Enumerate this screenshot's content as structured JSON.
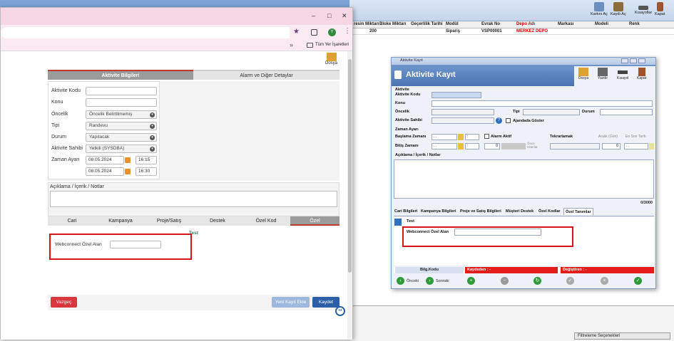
{
  "desktop": {
    "toolbar": [
      {
        "label": "Kartını Aç",
        "icon": "card-icon"
      },
      {
        "label": "Kaydı Aç",
        "icon": "record-icon"
      },
      {
        "label": "Kısayollar",
        "icon": "shortcuts-icon"
      },
      {
        "label": "Kapat",
        "icon": "close-door-icon"
      }
    ],
    "grid_headers": [
      "resin Miktarı",
      "Bloke Miktarı",
      "Geçerlilik Tarihi",
      "Modül",
      "Evrak No",
      "Depo Adı",
      "Markası",
      "Modeli",
      "Renk"
    ],
    "grid_row": [
      "200",
      "",
      "",
      "Sipariş",
      "VSP00001",
      "MERKEZ DEPO",
      "",
      "",
      ""
    ],
    "filter_label": "Filtreleme Seçenekleri"
  },
  "browser": {
    "bookmark": "Tüm Yer İşaretleri",
    "profile": "Y",
    "toolbar": {
      "dosya": "Dosya"
    },
    "tabs": {
      "active": "Aktivite Bilgileri",
      "other": "Alarm ve Diğer Detaylar"
    },
    "form": {
      "labels": {
        "code": "Aktivite Kodu",
        "subject": "Konu",
        "priority": "Öncelik",
        "type": "Tipi",
        "status": "Durum",
        "owner": "Aktivite Sahibi",
        "time": "Zaman Ayarı"
      },
      "priority": "Öncelik Belirtilmemiş",
      "type": "Randevu",
      "status": "Yapılacak",
      "owner": "Yetkili  (SYSDBA)",
      "start_date": "08.05.2024",
      "start_time": "16:15",
      "end_date": "08.05.2024",
      "end_time": "16:30",
      "notes_label": "Açıklama / İçerik / Notlar"
    },
    "subtabs": [
      "Cari",
      "Kampanya",
      "Proje/Satış",
      "Destek",
      "Özel Kod",
      "Özel"
    ],
    "special": {
      "group": "Test",
      "field_label": "Webconnect Özel Alan"
    },
    "buttons": {
      "cancel": "Vazgeç",
      "new": "Yeni Kayıt Ekle",
      "save": "Kaydet"
    }
  },
  "dialog": {
    "window_title": "Aktivite Kayıt",
    "title": "Aktivite Kayıt",
    "toolbar": [
      "Dosya",
      "Yazdır",
      "Kısayol",
      "Kapat"
    ],
    "section": "Aktivite",
    "labels": {
      "code": "Aktivite Kodu",
      "subject": "Konu",
      "priority": "Öncelik",
      "owner": "Aktivite Sahibi",
      "type": "Tipi",
      "status": "Durum",
      "agenda": "Ajandada Göster",
      "time": "Zaman Ayarı",
      "start": "Başlama Zamanı",
      "end": "Bitiş Zamanı",
      "alarm": "Alarm Aktif",
      "before": "Önce Hatırlat",
      "repeat": "Tekrarlamak",
      "interval": "Aralık (Gün)",
      "last_date": "En Son Tarih",
      "notes": "Açıklama / İçerik / Notlar"
    },
    "date_placeholder": ". .",
    "time_placeholder": ":",
    "alarm_value": "0",
    "interval_value": "0",
    "counter": "0/3000",
    "tabs": [
      "Cari Bilgileri",
      "Kampanya Bilgileri",
      "Proje ve Satış Bilgileri",
      "Müşteri Destek",
      "Özel Kodlar",
      "Özel Tanımlar"
    ],
    "special": {
      "group": "Test",
      "field_label": "Webconnect Özel Alan"
    },
    "status_bar": {
      "info": "Bilg.Kodu",
      "saved": "Kaydeden :  -",
      "changed": "Değiştiren :  -"
    },
    "nav": {
      "prev": "Önceki",
      "next": "Sonraki"
    }
  }
}
